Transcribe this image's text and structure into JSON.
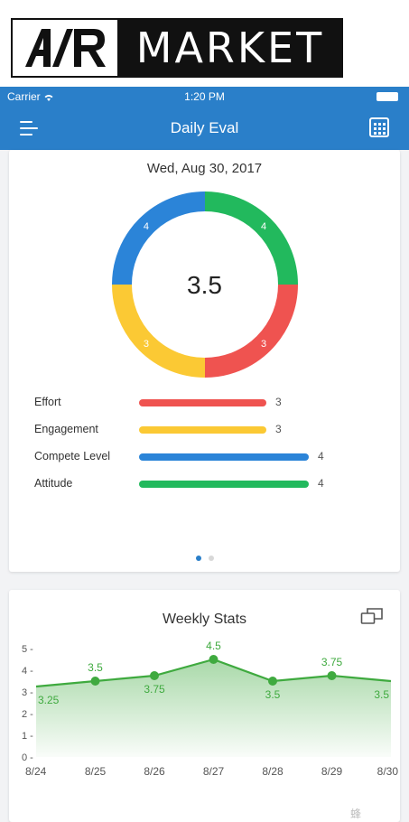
{
  "banner": {
    "brand_left": "A/R",
    "brand_right": "MARKET"
  },
  "status_bar": {
    "carrier": "Carrier",
    "time": "1:20 PM"
  },
  "nav": {
    "title": "Daily Eval",
    "left_icon": "menu-icon",
    "right_icon": "calendar-icon"
  },
  "daily": {
    "date": "Wed, Aug 30, 2017",
    "score": "3.5",
    "colors": {
      "effort": "#ef5350",
      "engagement": "#fbc934",
      "compete": "#2b84d8",
      "attitude": "#22b95d"
    },
    "metrics": [
      {
        "label": "Effort",
        "value": 3,
        "color": "#ef5350"
      },
      {
        "label": "Engagement",
        "value": 3,
        "color": "#fbc934"
      },
      {
        "label": "Compete Level",
        "value": 4,
        "color": "#2b84d8"
      },
      {
        "label": "Attitude",
        "value": 4,
        "color": "#22b95d"
      }
    ],
    "pager": {
      "pages": 2,
      "active": 0
    }
  },
  "weekly": {
    "title": "Weekly Stats",
    "expand_icon": "expand-icon"
  },
  "chart_data": {
    "type": "area",
    "title": "",
    "xlabel": "",
    "ylabel": "",
    "categories": [
      "8/24",
      "8/25",
      "8/26",
      "8/27",
      "8/28",
      "8/29",
      "8/30"
    ],
    "series": [
      {
        "values": [
          3.25,
          3.5,
          3.75,
          4.5,
          3.5,
          3.75,
          3.5
        ],
        "color": "#3faa3f"
      }
    ],
    "yticks": [
      "0",
      "1",
      "2",
      "3",
      "4",
      "5"
    ],
    "ylim": [
      0,
      5
    ],
    "grid": false,
    "legend": "none"
  },
  "footer": {
    "watermark": "蜂"
  }
}
